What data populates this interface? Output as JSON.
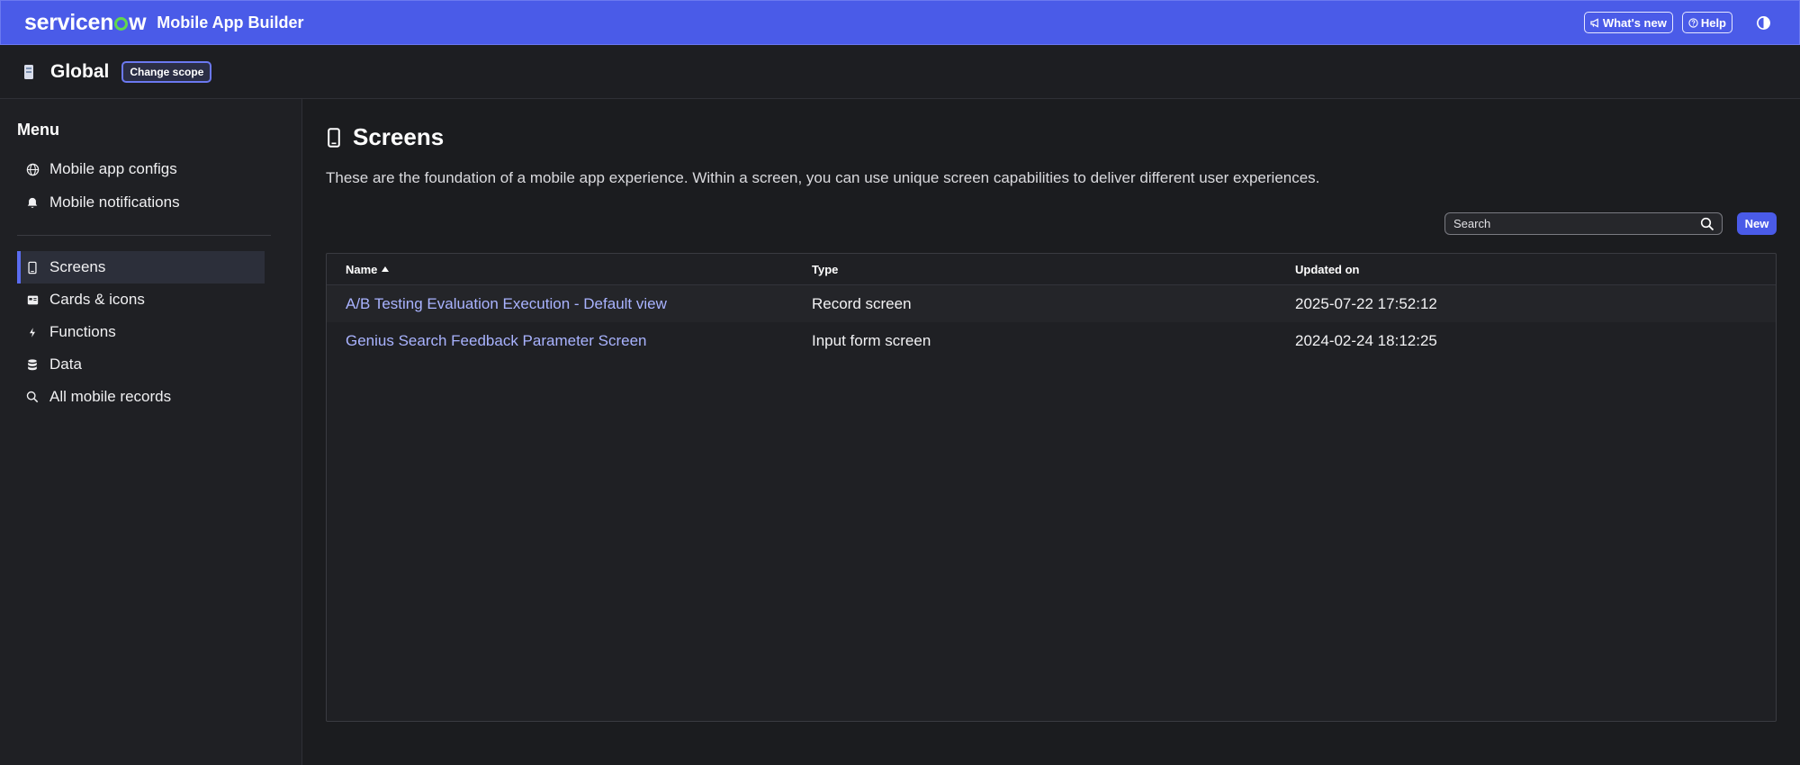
{
  "header": {
    "brand_prefix": "servicen",
    "brand_suffix": "w",
    "app_title": "Mobile App Builder",
    "whats_new_label": "What's new",
    "help_label": "Help"
  },
  "scope": {
    "name": "Global",
    "change_label": "Change scope"
  },
  "sidebar": {
    "menu_title": "Menu",
    "items": [
      {
        "label": "Mobile app configs",
        "icon": "globe-icon"
      },
      {
        "label": "Mobile notifications",
        "icon": "bell-icon"
      },
      {
        "label": "Screens",
        "icon": "phone-icon",
        "active": true
      },
      {
        "label": "Cards & icons",
        "icon": "card-icon"
      },
      {
        "label": "Functions",
        "icon": "function-icon"
      },
      {
        "label": "Data",
        "icon": "database-icon"
      },
      {
        "label": "All mobile records",
        "icon": "search-icon"
      }
    ]
  },
  "main": {
    "title": "Screens",
    "description": "These are the foundation of a mobile app experience. Within a screen, you can use unique screen capabilities to deliver different user experiences.",
    "search_placeholder": "Search",
    "new_label": "New",
    "table": {
      "columns": [
        "Name",
        "Type",
        "Updated on"
      ],
      "sort_column": "Name",
      "sort_direction": "ascending",
      "rows": [
        {
          "name": "A/B Testing Evaluation Execution - Default view",
          "type": "Record screen",
          "updated": "2025-07-22 17:52:12"
        },
        {
          "name": "Genius Search Feedback Parameter Screen",
          "type": "Input form screen",
          "updated": "2024-02-24 18:12:25"
        }
      ]
    }
  },
  "colors": {
    "header_bg": "#4a5be8",
    "accent": "#5a6cf0",
    "link": "#a9b3ff",
    "logo_green": "#62d84e"
  }
}
